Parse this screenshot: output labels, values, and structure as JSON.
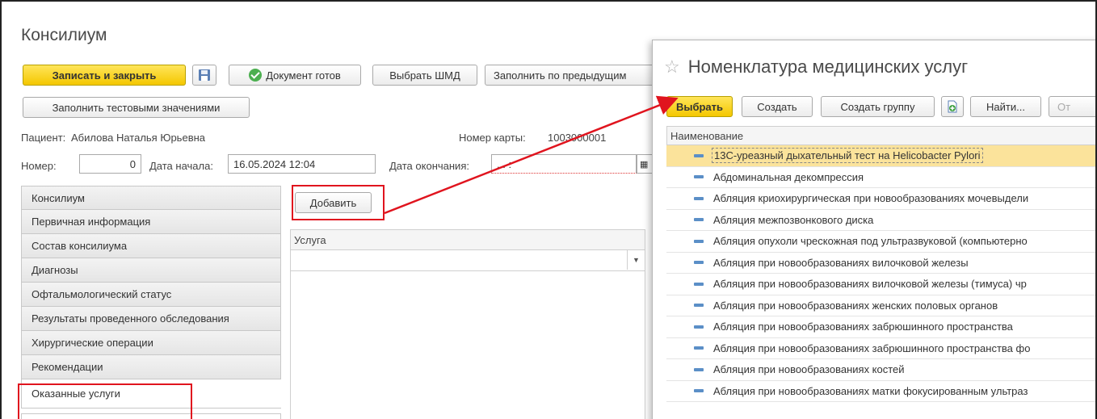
{
  "main": {
    "title": "Консилиум",
    "toolbar": {
      "save_close": "Записать и закрыть",
      "doc_ready": "Документ готов",
      "choose_shmd": "Выбрать ШМД",
      "fill_prev": "Заполнить по предыдущим",
      "fill_test": "Заполнить тестовыми значениями"
    },
    "patient_label": "Пациент:",
    "patient_name": "Абилова Наталья Юрьевна",
    "card_label": "Номер карты:",
    "card_value": "1003000001",
    "number_label": "Номер:",
    "number_value": "0",
    "start_label": "Дата начала:",
    "start_value": "16.05.2024 12:04",
    "end_label": "Дата окончания:",
    "end_value": " .  .       :  ",
    "nav_items": [
      "Консилиум",
      "Первичная информация",
      "Состав консилиума",
      "Диагнозы",
      "Офтальмологический статус",
      "Результаты проведенного обследования",
      "Хирургические операции",
      "Рекомендации",
      "Оказанные услуги"
    ],
    "add_button": "Добавить",
    "grid_header": "Услуга"
  },
  "popup": {
    "title": "Номенклатура медицинских услуг",
    "toolbar": {
      "select": "Выбрать",
      "create": "Создать",
      "create_group": "Создать группу",
      "find": "Найти...",
      "cut_label": "От"
    },
    "column_header": "Наименование",
    "rows": [
      "13С-уреазный дыхательный тест на Helicobacter Pylori",
      "Абдоминальная декомпрессия",
      "Абляция криохирургическая при новообразованиях мочевыдели",
      "Абляция межпозвонкового диска",
      "Абляция опухоли чрескожная под ультразвуковой (компьютерно",
      "Абляция при новообразованиях вилочковой железы",
      "Абляция при новообразованиях вилочковой железы (тимуса) чр",
      "Абляция при новообразованиях женских половых органов",
      "Абляция при новообразованиях забрюшинного пространства",
      "Абляция при новообразованиях забрюшинного пространства фо",
      "Абляция при новообразованиях костей",
      "Абляция при новообразованиях матки фокусированным ультраз"
    ]
  },
  "colors": {
    "accent_yellow": "#f4c700",
    "highlight_red": "#e0141e",
    "selected_row": "#fbe39b"
  }
}
